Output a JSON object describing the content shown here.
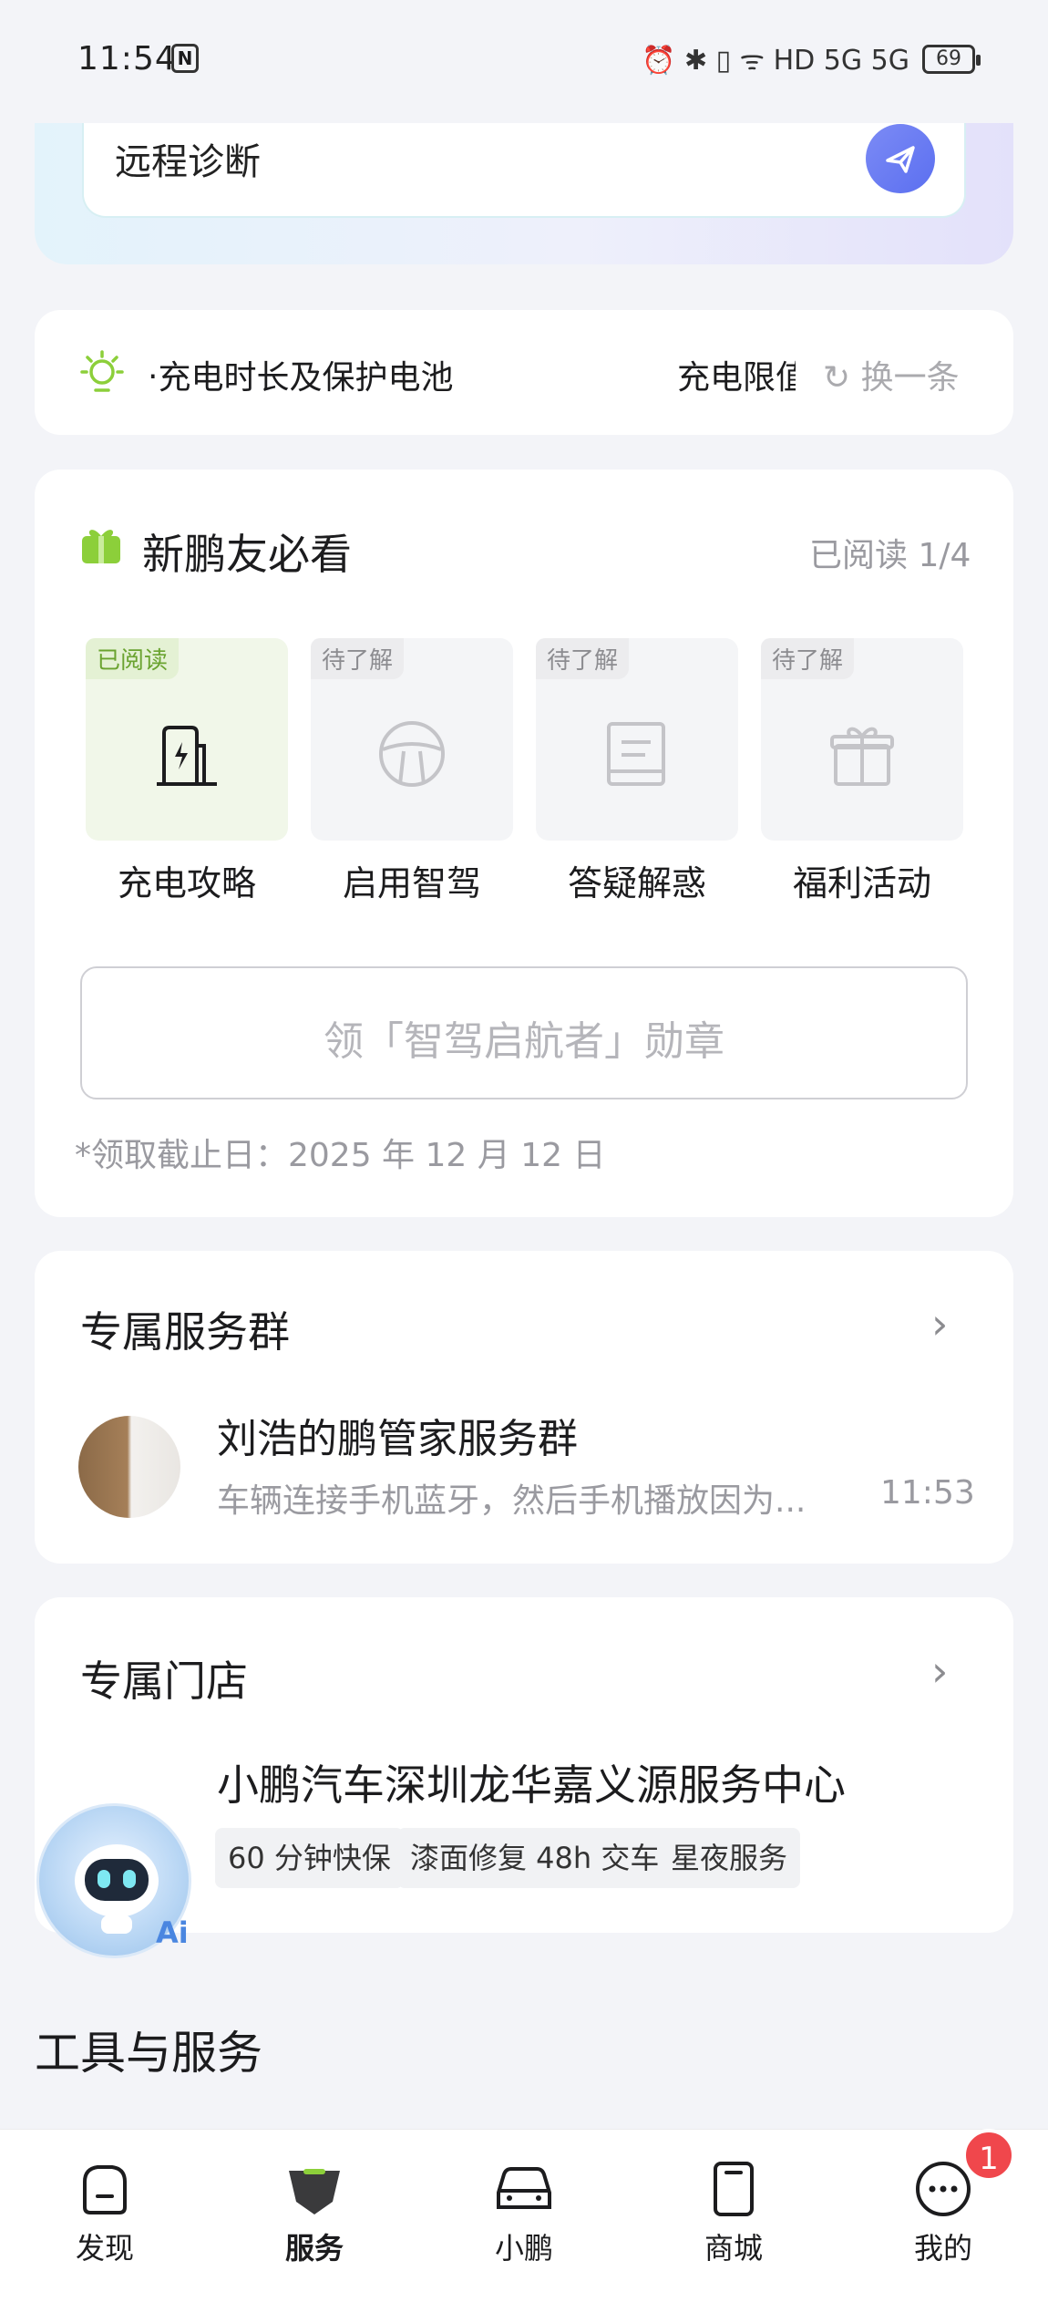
{
  "status_bar": {
    "time": "11:54",
    "nfc": "N",
    "signal_text": "⏰ ✱ ▯ ᯤ HD 5G 5G",
    "battery": "69"
  },
  "diagnosis": {
    "label": "远程诊断"
  },
  "tip_bar": {
    "text": "‧充电时长及保护电池",
    "text2": "充电限值",
    "refresh_label": "换一条"
  },
  "new_friend": {
    "title": "新鹏友必看",
    "read_status": "已阅读 1/4",
    "tiles": [
      {
        "tag": "已阅读",
        "label": "充电攻略",
        "icon": "charger-icon"
      },
      {
        "tag": "待了解",
        "label": "启用智驾",
        "icon": "steering-wheel-icon"
      },
      {
        "tag": "待了解",
        "label": "答疑解惑",
        "icon": "book-icon"
      },
      {
        "tag": "待了解",
        "label": "福利活动",
        "icon": "gift-icon"
      }
    ],
    "badge_button": "领「智驾启航者」勋章",
    "deadline": "*领取截止日：2025 年 12 月 12 日"
  },
  "service_group": {
    "title": "专属服务群",
    "group_name": "刘浩的鹏管家服务群",
    "last_message": "车辆连接手机蓝牙，然后手机播放因为...",
    "time": "11:53"
  },
  "store": {
    "title": "专属门店",
    "name": "小鹏汽车深圳龙华嘉义源服务中心",
    "chips": [
      "60 分钟快保",
      "漆面修复 48h 交车",
      "星夜服务"
    ]
  },
  "ai_assistant": {
    "label": "Ai"
  },
  "tools": {
    "title": "工具与服务"
  },
  "bottom_nav": {
    "items": [
      {
        "label": "发现",
        "icon": "discover-icon"
      },
      {
        "label": "服务",
        "icon": "service-icon"
      },
      {
        "label": "小鹏",
        "icon": "car-icon"
      },
      {
        "label": "商城",
        "icon": "shop-icon"
      },
      {
        "label": "我的",
        "icon": "profile-icon"
      }
    ],
    "active": "服务",
    "profile_badge": "1"
  },
  "colors": {
    "accent_green": "#8ccf3a",
    "send_button": "#6a7cf3",
    "badge_red": "#f0474c"
  }
}
